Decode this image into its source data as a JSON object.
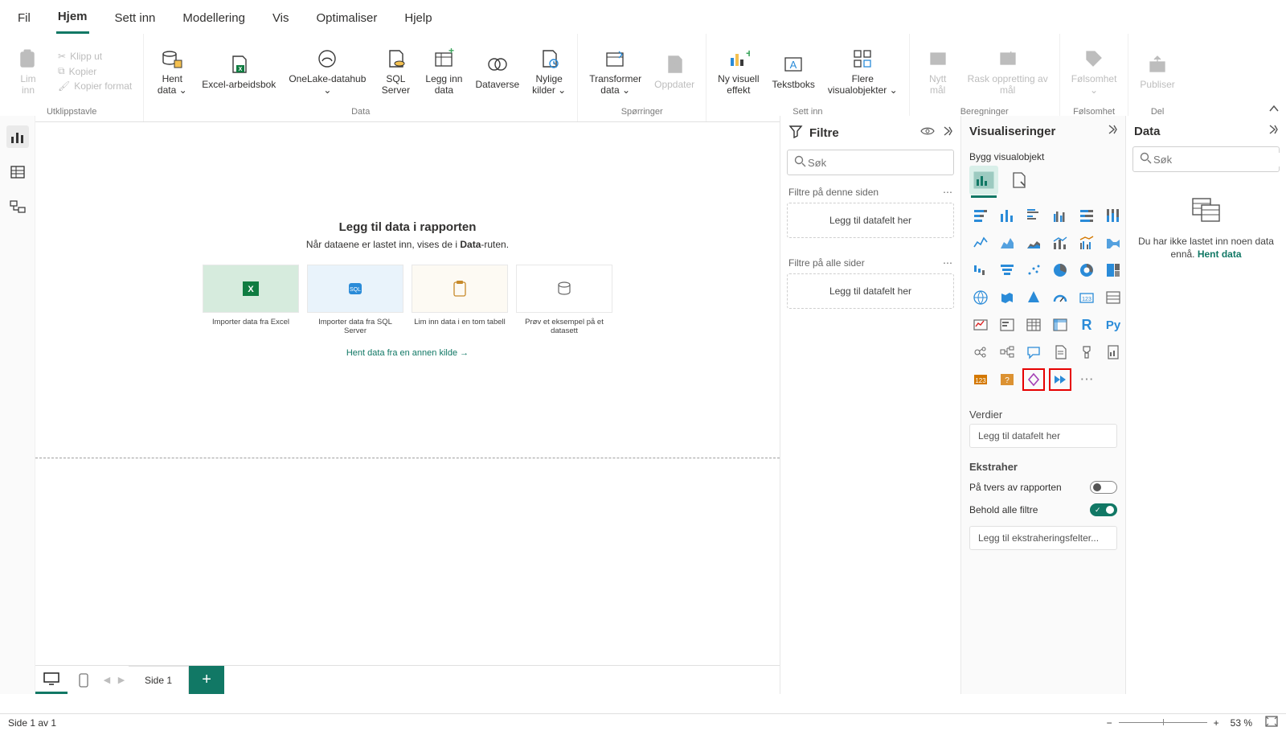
{
  "tabs": {
    "items": [
      "Fil",
      "Hjem",
      "Sett inn",
      "Modellering",
      "Vis",
      "Optimaliser",
      "Hjelp"
    ],
    "active": 1
  },
  "ribbon": {
    "clipboard": {
      "paste": "Lim\ninn",
      "cut": "Klipp ut",
      "copy": "Kopier",
      "format": "Kopier format",
      "group": "Utklippstavle"
    },
    "data": {
      "get": "Hent\ndata ⌄",
      "excel": "Excel-arbeidsbok",
      "onelake": "OneLake-datahub\n⌄",
      "sql": "SQL\nServer",
      "enter": "Legg inn\ndata",
      "dataverse": "Dataverse",
      "recent": "Nylige\nkilder ⌄",
      "group": "Data"
    },
    "queries": {
      "transform": "Transformer\ndata ⌄",
      "refresh": "Oppdater",
      "group": "Spørringer"
    },
    "insert": {
      "visual": "Ny visuell\neffekt",
      "textbox": "Tekstboks",
      "more": "Flere\nvisualobjekter ⌄",
      "group": "Sett inn"
    },
    "calc": {
      "measure": "Nytt\nmål",
      "quick": "Rask oppretting av\nmål",
      "group": "Beregninger"
    },
    "sens": {
      "btn": "Følsomhet\n⌄",
      "group": "Følsomhet"
    },
    "share": {
      "btn": "Publiser",
      "group": "Del"
    }
  },
  "canvas": {
    "title": "Legg til data i rapporten",
    "subtitle_pre": "Når dataene er lastet inn, vises de i ",
    "subtitle_bold": "Data",
    "subtitle_post": "-ruten.",
    "cards": [
      {
        "label": "Importer data fra Excel"
      },
      {
        "label": "Importer data fra SQL Server"
      },
      {
        "label": "Lim inn data i en tom tabell"
      },
      {
        "label": "Prøv et eksempel på et datasett"
      }
    ],
    "more": "Hent data fra en annen kilde →"
  },
  "pages": {
    "tab": "Side 1"
  },
  "filters": {
    "title": "Filtre",
    "search": "Søk",
    "this_page": "Filtre på denne siden",
    "all_pages": "Filtre på alle sider",
    "drop": "Legg til datafelt her"
  },
  "viz": {
    "title": "Visualiseringer",
    "subtitle": "Bygg visualobjekt",
    "values": "Verdier",
    "values_drop": "Legg til datafelt her",
    "drill": "Ekstraher",
    "cross": "På tvers av rapporten",
    "keep": "Behold alle filtre",
    "drill_drop": "Legg til ekstraheringsfelter..."
  },
  "dataPane": {
    "title": "Data",
    "search": "Søk",
    "empty_pre": "Du har ikke lastet inn noen data ennå. ",
    "empty_link": "Hent data"
  },
  "status": {
    "page": "Side 1 av 1",
    "zoom": "53 %"
  }
}
